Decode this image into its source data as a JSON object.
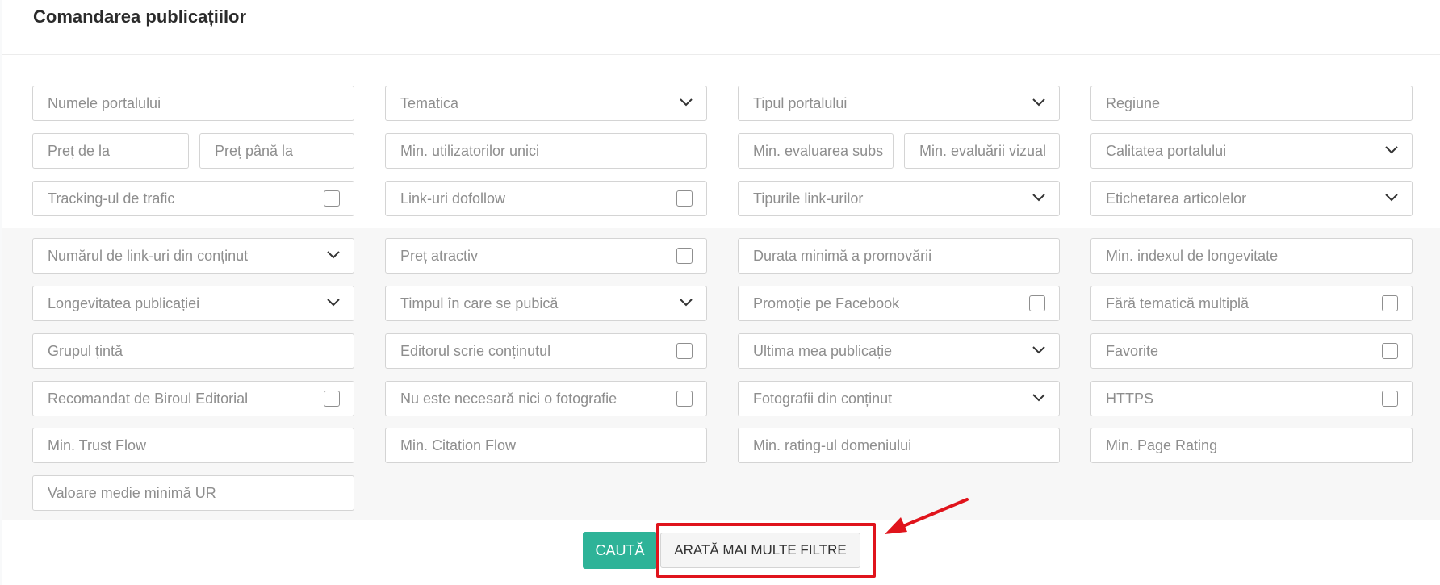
{
  "title": "Comandarea publicațiilor",
  "fields": [
    {
      "label": "Numele portalului"
    },
    {
      "label": "Tematica",
      "control": "dropdown"
    },
    {
      "label": "Tipul portalului",
      "control": "dropdown"
    },
    {
      "label": "Regiune"
    },
    {
      "label": "Preț de la"
    },
    {
      "label": "Preț până la"
    },
    {
      "label": "Min. utilizatorilor unici"
    },
    {
      "label": "Min. evaluarea subs"
    },
    {
      "label": "Min. evaluării vizual"
    },
    {
      "label": "Calitatea portalului",
      "control": "dropdown"
    },
    {
      "label": "Tracking-ul de trafic",
      "control": "checkbox",
      "checked": false
    },
    {
      "label": "Link-uri dofollow",
      "control": "checkbox",
      "checked": false
    },
    {
      "label": "Tipurile link-urilor",
      "control": "dropdown"
    },
    {
      "label": "Etichetarea articolelor",
      "control": "dropdown"
    },
    {
      "label": "Numărul de link-uri din conținut",
      "control": "dropdown"
    },
    {
      "label": "Preț atractiv",
      "control": "checkbox",
      "checked": false
    },
    {
      "label": "Durata minimă a promovării"
    },
    {
      "label": "Min. indexul de longevitate"
    },
    {
      "label": "Longevitatea publicației",
      "control": "dropdown"
    },
    {
      "label": "Timpul în care se pubică",
      "control": "dropdown"
    },
    {
      "label": "Promoție pe Facebook",
      "control": "checkbox",
      "checked": false
    },
    {
      "label": "Fără tematică multiplă",
      "control": "checkbox",
      "checked": false
    },
    {
      "label": "Grupul țintă"
    },
    {
      "label": "Editorul scrie conținutul",
      "control": "checkbox",
      "checked": false
    },
    {
      "label": "Ultima mea publicație",
      "control": "dropdown"
    },
    {
      "label": "Favorite",
      "control": "checkbox",
      "checked": false
    },
    {
      "label": "Recomandat de Biroul Editorial",
      "control": "checkbox",
      "checked": false
    },
    {
      "label": "Nu este necesară nici o fotografie",
      "control": "checkbox",
      "checked": false
    },
    {
      "label": "Fotografii din conținut",
      "control": "dropdown"
    },
    {
      "label": "HTTPS",
      "control": "checkbox",
      "checked": false
    },
    {
      "label": "Min. Trust Flow"
    },
    {
      "label": "Min. Citation Flow"
    },
    {
      "label": "Min. rating-ul domeniului"
    },
    {
      "label": "Min. Page Rating"
    },
    {
      "label": "Valoare medie minimă UR"
    }
  ],
  "buttons": {
    "search": "CAUTĂ",
    "more_filters": "ARATĂ MAI MULTE FILTRE"
  },
  "colors": {
    "search_button": "#2eb398",
    "highlight": "#e0141c"
  }
}
